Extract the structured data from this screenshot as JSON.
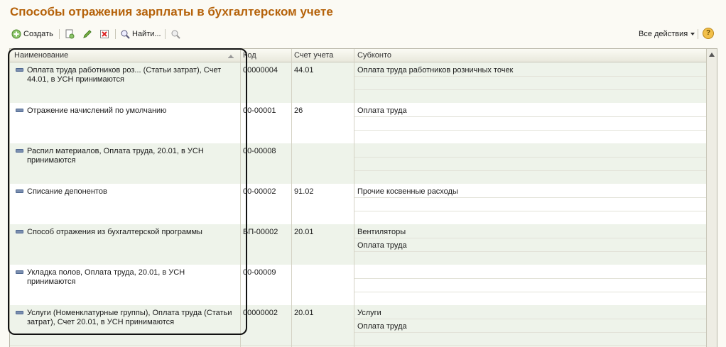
{
  "title": "Способы отражения зарплаты  в бухгалтерском учете",
  "toolbar": {
    "create_label": "Создать",
    "find_label": "Найти...",
    "all_actions_label": "Все действия",
    "help_label": "?"
  },
  "columns": {
    "name": "Наименование",
    "code": "Код",
    "account": "Счет учета",
    "subkonto": "Субконто"
  },
  "rows": [
    {
      "name": "Оплата труда работников роз... (Статьи затрат), Счет 44.01, в УСН принимаются",
      "code": "00000004",
      "account": "44.01",
      "sub1": "Оплата труда работников розничных точек",
      "sub2": ""
    },
    {
      "name": "Отражение начислений по умолчанию",
      "code": "00-00001",
      "account": "26",
      "sub1": "Оплата труда",
      "sub2": ""
    },
    {
      "name": "Распил материалов, Оплата труда, 20.01, в УСН принимаются",
      "code": "00-00008",
      "account": "",
      "sub1": "",
      "sub2": ""
    },
    {
      "name": "Списание депонентов",
      "code": "00-00002",
      "account": "91.02",
      "sub1": "Прочие косвенные расходы",
      "sub2": ""
    },
    {
      "name": "Способ отражения из бухгалтерской программы",
      "code": "БП-00002",
      "account": "20.01",
      "sub1": "Вентиляторы",
      "sub2": "Оплата труда"
    },
    {
      "name": "Укладка полов, Оплата труда, 20.01, в УСН принимаются",
      "code": "00-00009",
      "account": "",
      "sub1": "",
      "sub2": ""
    },
    {
      "name": "Услуги (Номенклатурные группы), Оплата труда (Статьи затрат), Счет 20.01, в УСН принимаются",
      "code": "00000002",
      "account": "20.01",
      "sub1": "Услуги",
      "sub2": "Оплата труда"
    }
  ]
}
